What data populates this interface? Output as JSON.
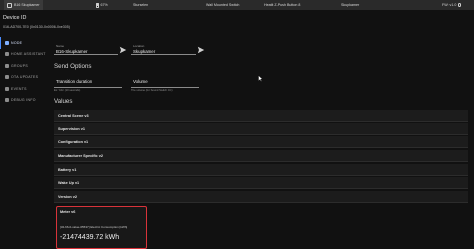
{
  "topbar": {
    "items": [
      {
        "label": "B16 Skupkamer",
        "icon": "device-square-icon"
      },
      {
        "label": "67%",
        "icon": "battery-icon"
      },
      {
        "label": "Sturselen"
      },
      {
        "label": "Wall Mounted Switch"
      },
      {
        "label": "Heatit Z-Push Button 8"
      },
      {
        "label": "Skupkamer"
      },
      {
        "label": "FW: v1.0",
        "icon": "firmware-icon"
      }
    ]
  },
  "header": {
    "device_id_label": "Device ID",
    "device_id_value": "016-AD700-7E0 (0x0130-0x0006-0xe305)"
  },
  "sidebar": {
    "items": [
      {
        "label": "NODE"
      },
      {
        "label": "HOME ASSISTANT"
      },
      {
        "label": "GROUPS"
      },
      {
        "label": "OTA UPDATES"
      },
      {
        "label": "EVENTS"
      },
      {
        "label": "DEBUG INFO"
      }
    ]
  },
  "form": {
    "name_label": "Name",
    "name_value": "B16-Skupkamer",
    "location_label": "Location",
    "location_value": "Skupkamer",
    "send_options_title": "Send Options",
    "transition_label": "Transition duration",
    "transition_helper": "Ex: '10s' (10 seconds)",
    "volume_label": "Volume",
    "volume_helper": "The volume (for Sound Switch CC)"
  },
  "values": {
    "title": "Values",
    "rows": [
      {
        "label": "Central Scene v3"
      },
      {
        "label": "Supervision v1"
      },
      {
        "label": "Configuration v1"
      },
      {
        "label": "Manufacturer Specific v2"
      },
      {
        "label": "Battery v1"
      },
      {
        "label": "Wake Up v1"
      },
      {
        "label": "Version v2"
      }
    ]
  },
  "meter": {
    "title": "Meter v6",
    "description": "[32-66-0-value-65537] Electric Consumption [kWh]",
    "value": "-21474439.72 kWh",
    "border_color": "#d8333a"
  },
  "colors": {
    "accent": "#4a8cff",
    "highlight": "#d8333a",
    "background": "#111111",
    "topbar": "#2a2a2a"
  }
}
